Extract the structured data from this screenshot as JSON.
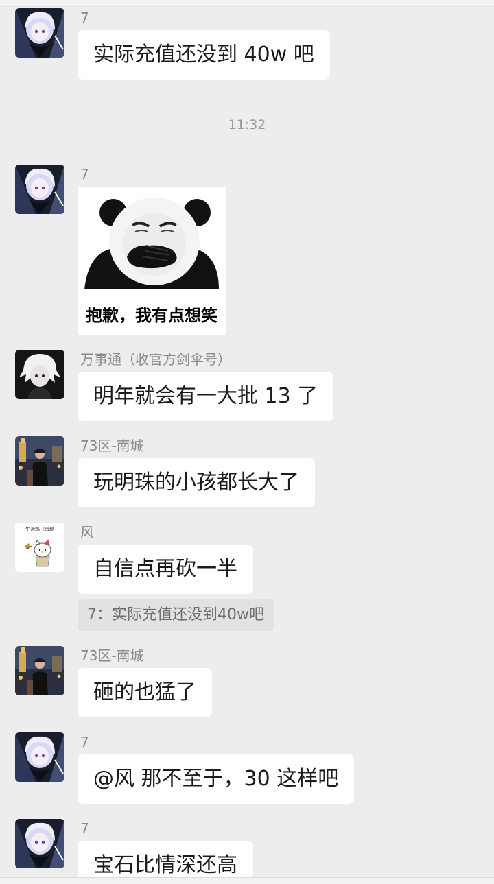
{
  "messages": [
    {
      "sender": "7",
      "text": "实际充值还没到 40w 吧"
    },
    {
      "sender": "7",
      "sticker_caption": "抱歉，我有点想笑"
    },
    {
      "sender": "万事通（收官方剑伞号）",
      "text": "明年就会有一大批 13 了"
    },
    {
      "sender": "73区-南城",
      "text": "玩明珠的小孩都长大了"
    },
    {
      "sender": "风",
      "text": "自信点再砍一半",
      "quote": "7：实际充值还没到40w吧",
      "avatar_text": "生活鸡飞蛋堤"
    },
    {
      "sender": "73区-南城",
      "text": "砸的也猛了"
    },
    {
      "sender": "7",
      "text": "@风  那不至于，30 这样吧"
    },
    {
      "sender": "7",
      "text": "宝石比情深还高"
    }
  ],
  "timestamp": "11:32",
  "colors": {
    "background": "#ededed",
    "bubble": "#ffffff",
    "quote_bg": "#e2e2e2",
    "sender_text": "#8a8a8a",
    "time_text": "#9a9a9a"
  },
  "icons": {
    "avatar_7": "anime-girl-avatar",
    "avatar_wanshitong": "white-hair-anime-avatar",
    "avatar_73": "photo-person-avatar",
    "avatar_feng": "hello-kitty-avatar"
  }
}
